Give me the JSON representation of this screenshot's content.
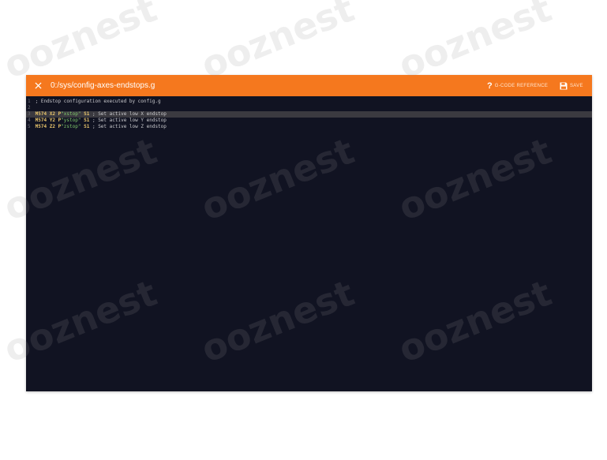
{
  "editor": {
    "file_path": "0:/sys/config-axes-endstops.g",
    "close_icon": "close-icon",
    "gcode_reference_icon": "question-icon",
    "gcode_reference_label": "G-CODE REFERENCE",
    "save_icon": "floppy-disk-icon",
    "save_label": "SAVE"
  },
  "code": {
    "lines": [
      {
        "number": "1",
        "text": "; Endstop configuration executed by config.g"
      },
      {
        "number": "2",
        "text": ""
      },
      {
        "number": "3",
        "cmd": "M574",
        "axis": "X2",
        "param": "P",
        "str": "\"xstop\"",
        "s": "S1",
        "comment": "; Set active low X endstop"
      },
      {
        "number": "4",
        "cmd": "M574",
        "axis": "Y2",
        "param": "P",
        "str": "\"ystop\"",
        "s": "S1",
        "comment": "; Set active low Y endstop"
      },
      {
        "number": "5",
        "cmd": "M574",
        "axis": "Z2",
        "param": "P",
        "str": "\"zstop\"",
        "s": "S1",
        "comment": "; Set active low Z endstop"
      }
    ],
    "active_line": 3
  },
  "watermark": {
    "text": "ooznest"
  },
  "colors": {
    "title_bar": "#f5781e",
    "editor_background": "#111322",
    "keyword": "#e6c36b",
    "string": "#7ec76a"
  }
}
